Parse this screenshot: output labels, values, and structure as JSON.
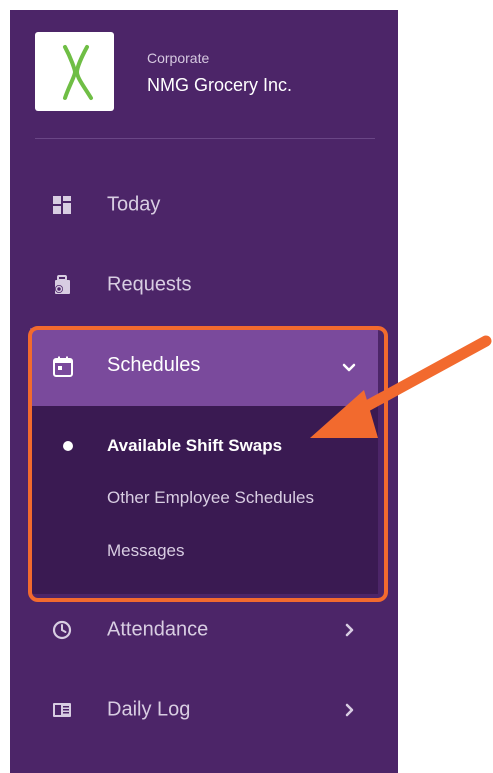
{
  "brand": {
    "subtitle": "Corporate",
    "name": "NMG Grocery Inc."
  },
  "nav": {
    "today": "Today",
    "requests": "Requests",
    "schedules": "Schedules",
    "attendance": "Attendance",
    "daily_log": "Daily Log"
  },
  "schedules_submenu": [
    {
      "label": "Available Shift Swaps",
      "active": true
    },
    {
      "label": "Other Employee Schedules",
      "active": false
    },
    {
      "label": "Messages",
      "active": false
    }
  ],
  "colors": {
    "sidebar_bg": "#4c2568",
    "active_header_bg": "#7a4a9c",
    "submenu_bg": "#3a1a52",
    "highlight_orange": "#f26a2e",
    "logo_green": "#6fbe45"
  }
}
